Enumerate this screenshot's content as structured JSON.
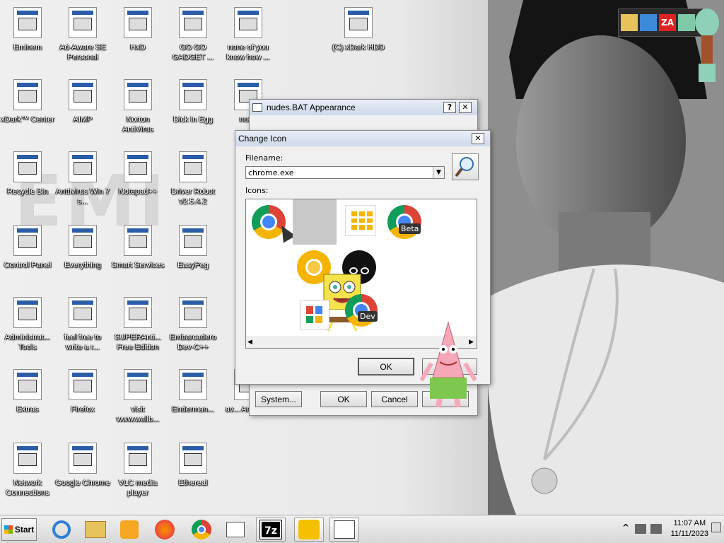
{
  "desktop_icons": [
    {
      "label": "Eminem"
    },
    {
      "label": "Ad-Aware SE Personal"
    },
    {
      "label": "HxD"
    },
    {
      "label": "GO GO GADGET ..."
    },
    {
      "label": "none of you know how ..."
    },
    {
      "label": "(C) xDark HDD"
    },
    {
      "label": "xDark™ Center"
    },
    {
      "label": "AIMP"
    },
    {
      "label": "Norton AntiVirus"
    },
    {
      "label": "Dick in Egg"
    },
    {
      "label": "nude"
    },
    {
      "label": "Recycle Bin"
    },
    {
      "label": "Anttivirus Win 7 s..."
    },
    {
      "label": "Notepad++"
    },
    {
      "label": "Driver Robot v2.5.4.2"
    },
    {
      "label": "Control Panel"
    },
    {
      "label": "Everything"
    },
    {
      "label": "Smart Services"
    },
    {
      "label": "EasyPeg"
    },
    {
      "label": "Administrat... Tools"
    },
    {
      "label": "feel free to write a r..."
    },
    {
      "label": "SUPERAnti... Free Edition"
    },
    {
      "label": "Embarcadero Dev-C++"
    },
    {
      "label": "Extras"
    },
    {
      "label": "Firefox"
    },
    {
      "label": "visit www.wallb..."
    },
    {
      "label": "Enderman..."
    },
    {
      "label": "av... Antivirus"
    },
    {
      "label": "Network Connections"
    },
    {
      "label": "Google Chrome"
    },
    {
      "label": "VLC media player"
    },
    {
      "label": "Ethereal"
    }
  ],
  "appearance_dialog": {
    "title": "nudes.BAT Appearance",
    "help": "?",
    "close": "✕",
    "system_button": "System...",
    "ok_button": "OK",
    "cancel_button": "Cancel"
  },
  "change_icon_dialog": {
    "title": "Change Icon",
    "close": "✕",
    "filename_label": "Filename:",
    "filename_value": "chrome.exe",
    "icons_label": "Icons:",
    "ok_button": "OK",
    "beta_label": "Beta",
    "dev_label": "Dev"
  },
  "taskbar": {
    "start_label": "Start",
    "time": "11:07 AM",
    "date": "11/11/2023",
    "show_hidden": "^"
  },
  "wallpaper_text": "EMI"
}
